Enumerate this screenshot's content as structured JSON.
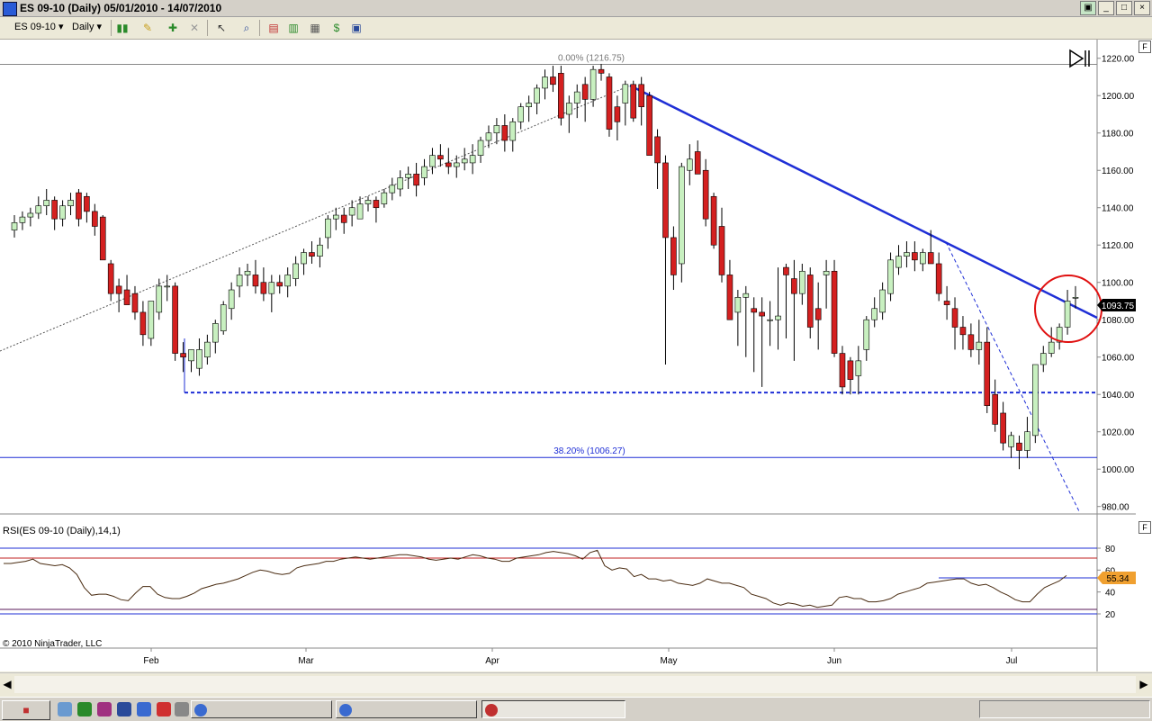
{
  "window": {
    "title": "ES 09-10 (Daily)  05/01/2010 - 14/07/2010",
    "min_label": "_",
    "max_label": "□",
    "close_label": "×",
    "restore_label": "▣"
  },
  "toolbar": {
    "instrument": "ES 09-10",
    "period": "Daily",
    "dropdown_glyph": "▾"
  },
  "price_panel": {
    "fib_top_label": "0.00% (1216.75)",
    "fib_382_label": "38.20% (1006.27)",
    "current_price": "1093.75",
    "right_badge": "F",
    "y_ticks": [
      980,
      1000,
      1020,
      1040,
      1060,
      1080,
      1100,
      1120,
      1140,
      1160,
      1180,
      1200,
      1220
    ]
  },
  "rsi_panel": {
    "title": "RSI(ES 09-10 (Daily),14,1)",
    "current_value": "55.34",
    "right_badge": "F",
    "y_ticks": [
      20,
      40,
      60,
      80
    ]
  },
  "x_axis": {
    "labels": [
      "Feb",
      "Mar",
      "Apr",
      "May",
      "Jun",
      "Jul"
    ]
  },
  "copyright": "© 2010 NinjaTrader, LLC",
  "colors": {
    "up_candle": "#c8f0c0",
    "down_candle": "#d42020",
    "trendline": "#1f2fd6",
    "rsi_line": "#4a2c12",
    "overbought": "#c02020",
    "circle": "#e01010"
  },
  "chart_data": {
    "type": "candlestick",
    "candles": [
      [
        1128,
        1136,
        1124,
        1132
      ],
      [
        1132,
        1138,
        1128,
        1135
      ],
      [
        1135,
        1140,
        1130,
        1137
      ],
      [
        1137,
        1146,
        1134,
        1141
      ],
      [
        1141,
        1150,
        1136,
        1144
      ],
      [
        1144,
        1146,
        1128,
        1134
      ],
      [
        1134,
        1144,
        1130,
        1141
      ],
      [
        1141,
        1148,
        1136,
        1144
      ],
      [
        1148,
        1150,
        1130,
        1134
      ],
      [
        1146,
        1148,
        1132,
        1138
      ],
      [
        1138,
        1142,
        1125,
        1130
      ],
      [
        1135,
        1136,
        1112,
        1112
      ],
      [
        1110,
        1112,
        1090,
        1094
      ],
      [
        1098,
        1102,
        1084,
        1094
      ],
      [
        1096,
        1104,
        1090,
        1088
      ],
      [
        1094,
        1098,
        1080,
        1084
      ],
      [
        1084,
        1090,
        1066,
        1072
      ],
      [
        1070,
        1090,
        1066,
        1090
      ],
      [
        1084,
        1102,
        1080,
        1098
      ],
      [
        1098,
        1104,
        1090,
        1098
      ],
      [
        1098,
        1100,
        1058,
        1062
      ],
      [
        1062,
        1068,
        1052,
        1060
      ],
      [
        1058,
        1064,
        1052,
        1064
      ],
      [
        1054,
        1070,
        1050,
        1064
      ],
      [
        1060,
        1072,
        1056,
        1068
      ],
      [
        1068,
        1080,
        1062,
        1078
      ],
      [
        1074,
        1090,
        1072,
        1088
      ],
      [
        1086,
        1100,
        1080,
        1096
      ],
      [
        1098,
        1108,
        1092,
        1104
      ],
      [
        1104,
        1110,
        1098,
        1106
      ],
      [
        1104,
        1112,
        1094,
        1098
      ],
      [
        1100,
        1108,
        1090,
        1094
      ],
      [
        1094,
        1104,
        1084,
        1100
      ],
      [
        1100,
        1104,
        1094,
        1098
      ],
      [
        1098,
        1108,
        1092,
        1104
      ],
      [
        1102,
        1114,
        1098,
        1110
      ],
      [
        1110,
        1118,
        1104,
        1116
      ],
      [
        1116,
        1122,
        1110,
        1114
      ],
      [
        1114,
        1124,
        1108,
        1120
      ],
      [
        1124,
        1136,
        1118,
        1134
      ],
      [
        1134,
        1140,
        1128,
        1136
      ],
      [
        1136,
        1140,
        1126,
        1132
      ],
      [
        1136,
        1144,
        1130,
        1140
      ],
      [
        1134,
        1146,
        1134,
        1142
      ],
      [
        1142,
        1146,
        1138,
        1144
      ],
      [
        1144,
        1146,
        1132,
        1140
      ],
      [
        1142,
        1150,
        1140,
        1148
      ],
      [
        1148,
        1156,
        1144,
        1152
      ],
      [
        1150,
        1160,
        1146,
        1156
      ],
      [
        1156,
        1162,
        1150,
        1158
      ],
      [
        1158,
        1164,
        1146,
        1152
      ],
      [
        1156,
        1166,
        1152,
        1162
      ],
      [
        1162,
        1172,
        1158,
        1168
      ],
      [
        1168,
        1174,
        1162,
        1166
      ],
      [
        1164,
        1172,
        1158,
        1162
      ],
      [
        1162,
        1168,
        1156,
        1164
      ],
      [
        1164,
        1172,
        1160,
        1166
      ],
      [
        1164,
        1174,
        1158,
        1168
      ],
      [
        1168,
        1178,
        1164,
        1176
      ],
      [
        1176,
        1184,
        1172,
        1180
      ],
      [
        1180,
        1188,
        1174,
        1184
      ],
      [
        1184,
        1190,
        1170,
        1176
      ],
      [
        1176,
        1188,
        1170,
        1186
      ],
      [
        1186,
        1196,
        1182,
        1194
      ],
      [
        1194,
        1200,
        1186,
        1196
      ],
      [
        1196,
        1206,
        1190,
        1204
      ],
      [
        1204,
        1214,
        1198,
        1210
      ],
      [
        1210,
        1216,
        1202,
        1206
      ],
      [
        1212,
        1216,
        1184,
        1188
      ],
      [
        1190,
        1200,
        1180,
        1196
      ],
      [
        1196,
        1206,
        1188,
        1202
      ],
      [
        1206,
        1210,
        1186,
        1198
      ],
      [
        1198,
        1216,
        1194,
        1214
      ],
      [
        1214,
        1217,
        1208,
        1212
      ],
      [
        1210,
        1212,
        1178,
        1182
      ],
      [
        1194,
        1200,
        1176,
        1186
      ],
      [
        1196,
        1208,
        1184,
        1206
      ],
      [
        1206,
        1208,
        1186,
        1188
      ],
      [
        1206,
        1210,
        1184,
        1194
      ],
      [
        1200,
        1202,
        1174,
        1168
      ],
      [
        1178,
        1182,
        1150,
        1164
      ],
      [
        1164,
        1168,
        1056,
        1124
      ],
      [
        1124,
        1130,
        1096,
        1104
      ],
      [
        1110,
        1164,
        1100,
        1162
      ],
      [
        1160,
        1174,
        1152,
        1166
      ],
      [
        1170,
        1176,
        1160,
        1158
      ],
      [
        1160,
        1166,
        1130,
        1134
      ],
      [
        1146,
        1148,
        1118,
        1120
      ],
      [
        1130,
        1140,
        1100,
        1104
      ],
      [
        1104,
        1112,
        1080,
        1080
      ],
      [
        1084,
        1096,
        1066,
        1092
      ],
      [
        1092,
        1098,
        1060,
        1094
      ],
      [
        1086,
        1092,
        1052,
        1084
      ],
      [
        1084,
        1092,
        1044,
        1082
      ],
      [
        1080,
        1090,
        1066,
        1080
      ],
      [
        1080,
        1108,
        1064,
        1082
      ],
      [
        1108,
        1110,
        1070,
        1104
      ],
      [
        1102,
        1112,
        1058,
        1094
      ],
      [
        1094,
        1110,
        1088,
        1106
      ],
      [
        1104,
        1108,
        1070,
        1076
      ],
      [
        1086,
        1100,
        1064,
        1080
      ],
      [
        1104,
        1112,
        1086,
        1106
      ],
      [
        1106,
        1112,
        1060,
        1062
      ],
      [
        1062,
        1066,
        1040,
        1044
      ],
      [
        1058,
        1060,
        1040,
        1048
      ],
      [
        1050,
        1066,
        1040,
        1058
      ],
      [
        1064,
        1082,
        1058,
        1080
      ],
      [
        1080,
        1092,
        1076,
        1086
      ],
      [
        1084,
        1100,
        1080,
        1096
      ],
      [
        1094,
        1116,
        1090,
        1112
      ],
      [
        1108,
        1120,
        1104,
        1114
      ],
      [
        1114,
        1122,
        1108,
        1116
      ],
      [
        1116,
        1122,
        1106,
        1112
      ],
      [
        1110,
        1118,
        1106,
        1116
      ],
      [
        1116,
        1128,
        1110,
        1110
      ],
      [
        1110,
        1116,
        1090,
        1094
      ],
      [
        1090,
        1098,
        1080,
        1088
      ],
      [
        1086,
        1092,
        1064,
        1076
      ],
      [
        1076,
        1082,
        1064,
        1072
      ],
      [
        1072,
        1078,
        1060,
        1064
      ],
      [
        1064,
        1080,
        1056,
        1068
      ],
      [
        1068,
        1076,
        1030,
        1034
      ],
      [
        1040,
        1048,
        1020,
        1024
      ],
      [
        1030,
        1036,
        1010,
        1014
      ],
      [
        1012,
        1020,
        1006,
        1018
      ],
      [
        1014,
        1018,
        1000,
        1010
      ],
      [
        1010,
        1028,
        1006,
        1020
      ],
      [
        1018,
        1040,
        1014,
        1056
      ],
      [
        1056,
        1066,
        1052,
        1062
      ],
      [
        1062,
        1076,
        1060,
        1068
      ],
      [
        1068,
        1078,
        1064,
        1076
      ],
      [
        1076,
        1096,
        1072,
        1090
      ],
      [
        1092,
        1098,
        1086,
        1092
      ]
    ],
    "rsi": [
      66,
      66,
      67,
      68,
      70,
      66,
      65,
      64,
      65,
      62,
      56,
      44,
      37,
      38,
      38,
      36,
      33,
      32,
      39,
      45,
      45,
      38,
      35,
      34,
      34,
      36,
      39,
      43,
      45,
      47,
      48,
      50,
      52,
      55,
      58,
      60,
      59,
      57,
      56,
      57,
      62,
      64,
      65,
      66,
      68,
      68,
      70,
      71,
      72,
      71,
      70,
      71,
      72,
      73,
      74,
      74,
      73,
      72,
      70,
      69,
      70,
      71,
      70,
      72,
      74,
      73,
      71,
      70,
      68,
      68,
      71,
      72,
      73,
      74,
      76,
      77,
      76,
      75,
      73,
      70,
      76,
      78,
      64,
      60,
      62,
      61,
      54,
      56,
      52,
      52,
      50,
      51,
      48,
      47,
      46,
      48,
      52,
      50,
      48,
      48,
      46,
      44,
      38,
      36,
      34,
      30,
      28,
      30,
      29,
      27,
      28,
      26,
      27,
      28,
      35,
      36,
      34,
      34,
      31,
      31,
      32,
      34,
      38,
      40,
      42,
      44,
      48,
      49,
      50,
      51,
      52,
      52,
      48,
      46,
      47,
      44,
      40,
      37,
      33,
      31,
      31,
      38,
      44,
      47,
      50,
      55
    ],
    "fib_0": 1216.75,
    "fib_382": 1006.27,
    "support": 1041,
    "ylim": [
      976,
      1230
    ],
    "rsi_ylim": [
      0,
      100
    ]
  }
}
